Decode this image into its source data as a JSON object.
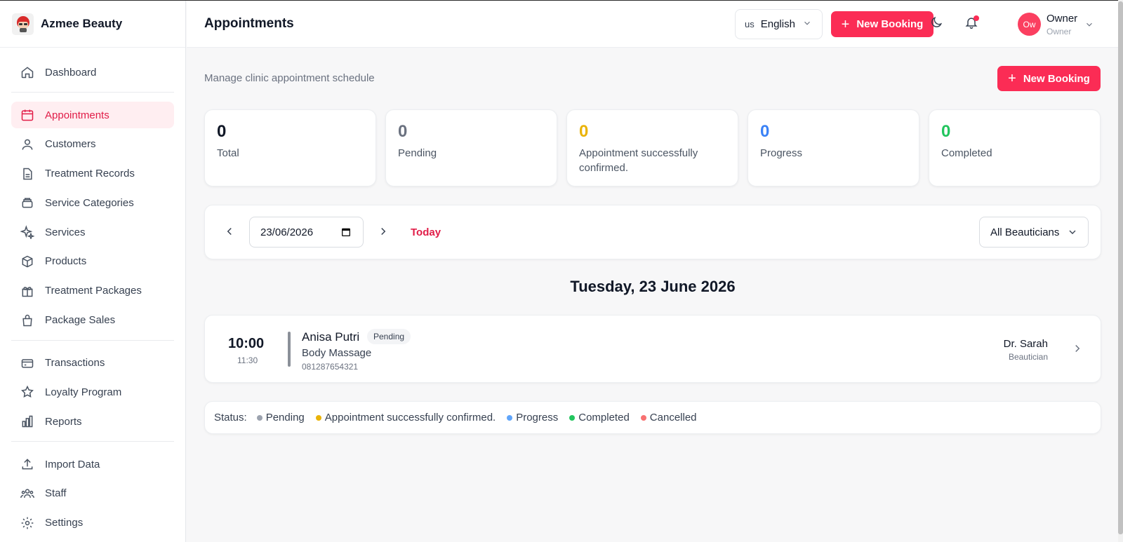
{
  "brand": {
    "name": "Azmee Beauty"
  },
  "header": {
    "title": "Appointments",
    "language_code": "us",
    "language": "English",
    "new_booking": "New Booking",
    "user": {
      "initials": "Ow",
      "name": "Owner",
      "role": "Owner"
    }
  },
  "sidebar": {
    "items": [
      {
        "label": "Dashboard",
        "icon": "home-icon"
      },
      {
        "label": "Appointments",
        "icon": "calendar-icon",
        "active": true
      },
      {
        "label": "Customers",
        "icon": "users-icon"
      },
      {
        "label": "Treatment Records",
        "icon": "document-icon"
      },
      {
        "label": "Service Categories",
        "icon": "layers-icon"
      },
      {
        "label": "Services",
        "icon": "sparkles-icon"
      },
      {
        "label": "Products",
        "icon": "box-icon"
      },
      {
        "label": "Treatment Packages",
        "icon": "gift-icon"
      },
      {
        "label": "Package Sales",
        "icon": "shopping-bag-icon"
      },
      {
        "label": "Transactions",
        "icon": "credit-card-icon"
      },
      {
        "label": "Loyalty Program",
        "icon": "star-icon"
      },
      {
        "label": "Reports",
        "icon": "bar-chart-icon"
      },
      {
        "label": "Import Data",
        "icon": "upload-icon"
      },
      {
        "label": "Staff",
        "icon": "team-icon"
      },
      {
        "label": "Settings",
        "icon": "gear-icon"
      }
    ]
  },
  "main": {
    "subtitle": "Manage clinic appointment schedule",
    "new_booking": "New Booking",
    "stats": [
      {
        "value": "0",
        "label": "Total",
        "color": "#111827"
      },
      {
        "value": "0",
        "label": "Pending",
        "color": "#6b7280"
      },
      {
        "value": "0",
        "label": "Appointment successfully confirmed.",
        "color": "#eab308"
      },
      {
        "value": "0",
        "label": "Progress",
        "color": "#3b82f6"
      },
      {
        "value": "0",
        "label": "Completed",
        "color": "#22c55e"
      }
    ],
    "date": "23/06/2026",
    "today": "Today",
    "beautician_filter": "All Beauticians",
    "day_heading": "Tuesday, 23 June 2026",
    "appointment": {
      "start": "10:00",
      "end": "11:30",
      "customer": "Anisa Putri",
      "status": "Pending",
      "service": "Body Massage",
      "phone": "081287654321",
      "beautician": "Dr. Sarah",
      "beautician_role": "Beautician"
    },
    "legend": {
      "title": "Status:",
      "items": [
        {
          "label": "Pending",
          "color": "#9ca3af"
        },
        {
          "label": "Appointment successfully confirmed.",
          "color": "#eab308"
        },
        {
          "label": "Progress",
          "color": "#60a5fa"
        },
        {
          "label": "Completed",
          "color": "#22c55e"
        },
        {
          "label": "Cancelled",
          "color": "#f87171"
        }
      ]
    }
  }
}
